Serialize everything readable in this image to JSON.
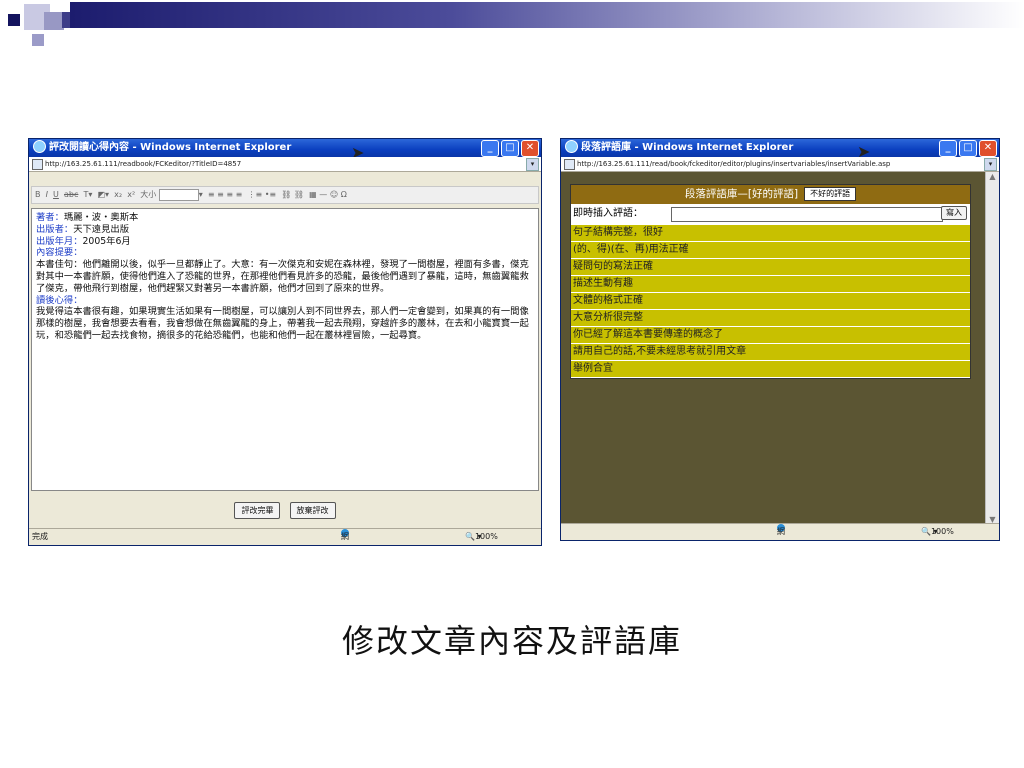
{
  "slide": {
    "caption": "修改文章內容及評語庫"
  },
  "left_window": {
    "title": "評改閱讀心得內容 - Windows Internet Explorer",
    "address": "http://163.25.61.111/readbook/FCKeditor/?TitleID=4857",
    "toolbar_size_label": "大小",
    "content": {
      "author_label": "著者：",
      "author": "瑪麗・波・奧斯本",
      "publisher_label": "出版者：",
      "publisher": "天下遠見出版",
      "year_label": "出版年月：",
      "year": "2005年6月",
      "summary_heading": "內容提要：",
      "summary_text": "本書佳句：他們離開以後，似乎一旦都靜止了。大意：有一次傑克和安妮在森林裡，發現了一間樹屋，裡面有多書，傑克對其中一本書許願，使得他們進入了恐龍的世界，在那裡他們看見許多的恐龍，最後他們遇到了暴龍，這時，無齒翼龍救了傑克，帶他飛行到樹屋，他們趕緊又對著另一本書許願，他們才回到了原來的世界。",
      "reflection_heading": "讀後心得：",
      "reflection_text": "我覺得這本書很有趣，如果現實生活如果有一間樹屋，可以讓別人到不同世界去，那人們一定會變到，如果真的有一間像那樣的樹屋，我會想要去看看，我會想做在無齒翼龍的身上，帶著我一起去飛翔，穿越許多的叢林，在去和小龍寶寶一起玩，和恐龍們一起去找食物，摘很多的花給恐龍們，也能和他們一起在叢林裡冒險，一起尋寶。"
    },
    "buttons": {
      "finish": "評改完畢",
      "discard": "放棄評改"
    },
    "status_left": "完成",
    "status_zone": "網際網路",
    "status_zoom": "100%"
  },
  "right_window": {
    "title": "段落評語庫 - Windows Internet Explorer",
    "address": "http://163.25.61.111/read/book/fckeditor/editor/plugins/insertvariables/insertVariable.asp",
    "panel_title": "段落評語庫—[好的評語]",
    "toggle_label": "不好的評語",
    "insert_label": "即時插入評語：",
    "insert_button": "寫入",
    "comments": [
      "句子結構完整，很好",
      "(的、得)(在、再)用法正確",
      "疑問句的寫法正確",
      "描述生動有趣",
      "文體的格式正確",
      "大意分析很完整",
      "你已經了解這本書要傳達的概念了",
      "請用自己的話,不要未經思考就引用文章",
      "舉例合宜"
    ],
    "status_zone": "網際網路",
    "status_zoom": "100%"
  },
  "colors": {
    "title_bar": "#0b3fbf",
    "panel_header": "#8f6b12",
    "comment_row": "#c8c000",
    "page_background": "#5b5533",
    "label_blue": "#1e3ec8"
  }
}
